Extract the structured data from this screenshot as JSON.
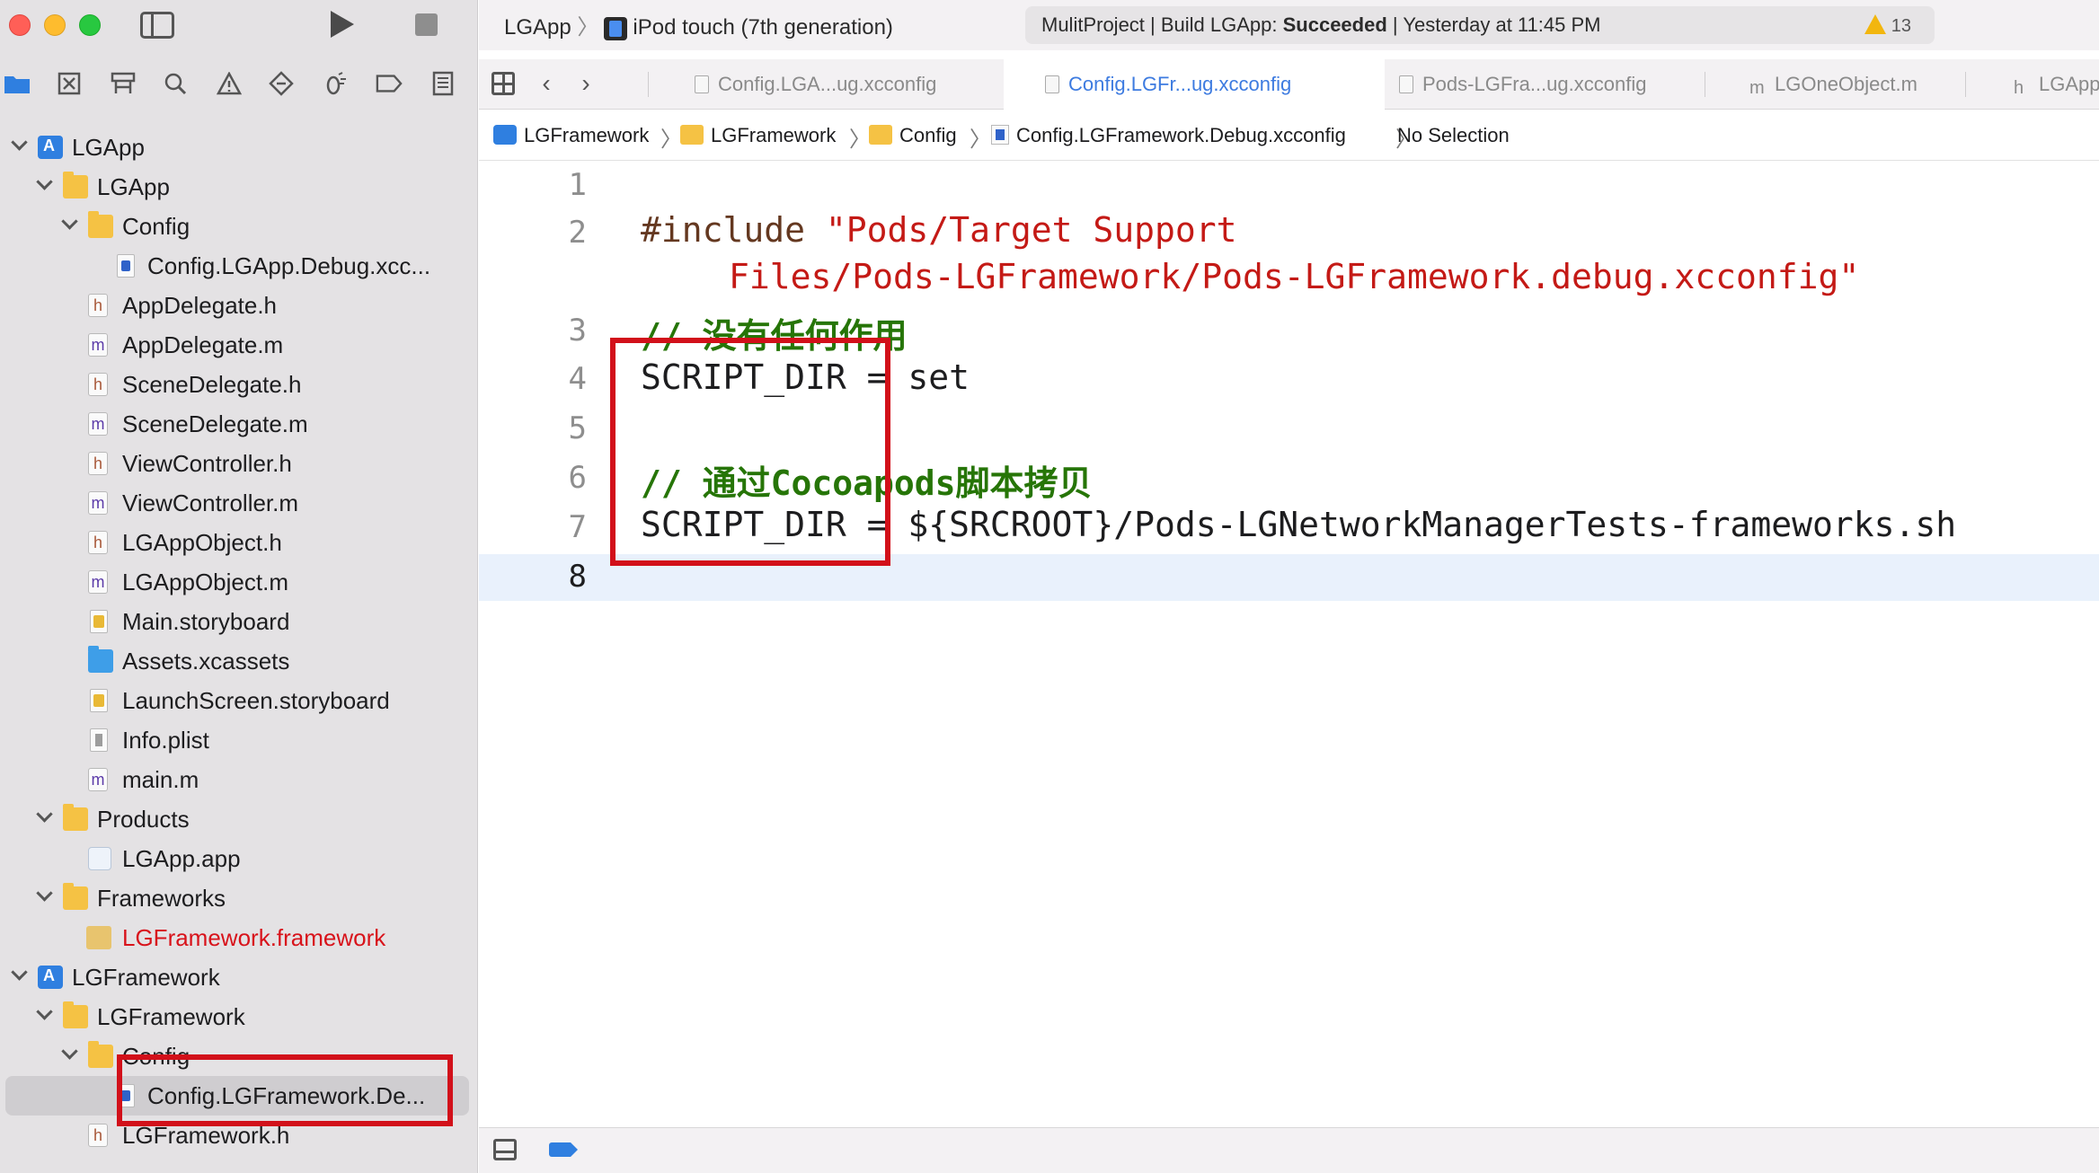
{
  "toolbar": {
    "scheme_project": "LGApp",
    "scheme_device": "iPod touch (7th generation)",
    "status_prefix": "MulitProject | Build LGApp: ",
    "status_result": "Succeeded",
    "status_suffix": " | Yesterday at 11:45 PM",
    "warning_count": "13"
  },
  "tabs": [
    {
      "label": "Config.LGA...ug.xcconfig",
      "active": false
    },
    {
      "label": "Config.LGFr...ug.xcconfig",
      "active": true
    },
    {
      "label": "Pods-LGFra...ug.xcconfig",
      "active": false
    },
    {
      "label": "LGOneObject.m",
      "active": false,
      "icon_letter": "m"
    },
    {
      "label": "LGApp",
      "active": false,
      "icon_letter": "h"
    }
  ],
  "jumpbar": {
    "items": [
      "LGFramework",
      "LGFramework",
      "Config",
      "Config.LGFramework.Debug.xcconfig",
      "No Selection"
    ]
  },
  "navigator": {
    "items": [
      {
        "label": "LGApp"
      },
      {
        "label": "LGApp"
      },
      {
        "label": "Config"
      },
      {
        "label": "Config.LGApp.Debug.xcc..."
      },
      {
        "label": "AppDelegate.h"
      },
      {
        "label": "AppDelegate.m"
      },
      {
        "label": "SceneDelegate.h"
      },
      {
        "label": "SceneDelegate.m"
      },
      {
        "label": "ViewController.h"
      },
      {
        "label": "ViewController.m"
      },
      {
        "label": "LGAppObject.h"
      },
      {
        "label": "LGAppObject.m"
      },
      {
        "label": "Main.storyboard"
      },
      {
        "label": "Assets.xcassets"
      },
      {
        "label": "LaunchScreen.storyboard"
      },
      {
        "label": "Info.plist"
      },
      {
        "label": "main.m"
      },
      {
        "label": "Products"
      },
      {
        "label": "LGApp.app"
      },
      {
        "label": "Frameworks"
      },
      {
        "label": "LGFramework.framework"
      },
      {
        "label": "LGFramework"
      },
      {
        "label": "LGFramework"
      },
      {
        "label": "Config"
      },
      {
        "label": "Config.LGFramework.De..."
      },
      {
        "label": "LGFramework.h"
      }
    ]
  },
  "editor": {
    "line_numbers": [
      "1",
      "2",
      "3",
      "4",
      "5",
      "6",
      "7",
      "8"
    ],
    "line2_directive": "#include",
    "line2_string_a": "\"Pods/Target Support",
    "line2_string_b": "Files/Pods-LGFramework/Pods-LGFramework.debug.xcconfig\"",
    "line3_comment": "// 没有任何作用",
    "line4_code": "SCRIPT_DIR = set",
    "line6_comment": "// 通过Cocoapods脚本拷贝",
    "line7_code": "SCRIPT_DIR = ${SRCROOT}/Pods-LGNetworkManagerTests-frameworks.sh"
  },
  "colors": {
    "accent": "#3d7be0",
    "annotation_red": "#d2101a",
    "comment_green": "#267507",
    "string_red": "#c41a16"
  }
}
